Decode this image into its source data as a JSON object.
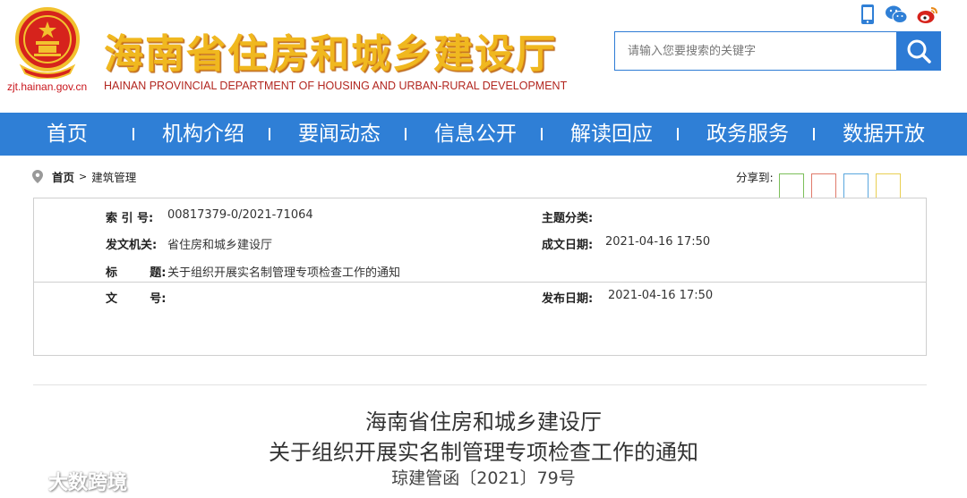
{
  "header": {
    "site_url": "zjt.hainan.gov.cn",
    "title": "海南省住房和城乡建设厅",
    "subtitle": "HAINAN PROVINCIAL DEPARTMENT OF HOUSING AND URBAN-RURAL DEVELOPMENT",
    "top_icons": [
      "mobile-icon",
      "wechat-icon",
      "weibo-icon"
    ]
  },
  "search": {
    "placeholder": "请输入您要搜索的关键字",
    "button_icon": "search-icon"
  },
  "nav": {
    "items": [
      "首页",
      "机构介绍",
      "要闻动态",
      "信息公开",
      "解读回应",
      "政务服务",
      "数据开放"
    ]
  },
  "breadcrumb": {
    "home": "首页",
    "separator": ">",
    "current": "建筑管理"
  },
  "share": {
    "label": "分享到:",
    "colors": [
      "#7cbf5a",
      "#e07a6a",
      "#5aa7de",
      "#e9cf52"
    ]
  },
  "info": {
    "index_label": "索  引  号:",
    "index_value": "00817379-0/2021-71064",
    "topic_label": "主题分类:",
    "topic_value": "",
    "issuer_label": "发文机关:",
    "issuer_value": "省住房和城乡建设厅",
    "date_label": "成文日期:",
    "date_value": "2021-04-16 17:50",
    "title_label": "标        题:",
    "title_value": "关于组织开展实名制管理专项检查工作的通知",
    "docno_label": "文        号:",
    "docno_value": "",
    "pub_label": "发布日期:",
    "pub_value": "2021-04-16 17:50"
  },
  "document": {
    "line1": "海南省住房和城乡建设厅",
    "line2": "关于组织开展实名制管理专项检查工作的通知",
    "line3": "琼建管函〔2021〕79号"
  },
  "watermark": {
    "text": "大数跨境"
  },
  "colors": {
    "nav_bg": "#2f7fd6",
    "title_gold": "#f0b81f",
    "brand_red": "#c9161d"
  }
}
